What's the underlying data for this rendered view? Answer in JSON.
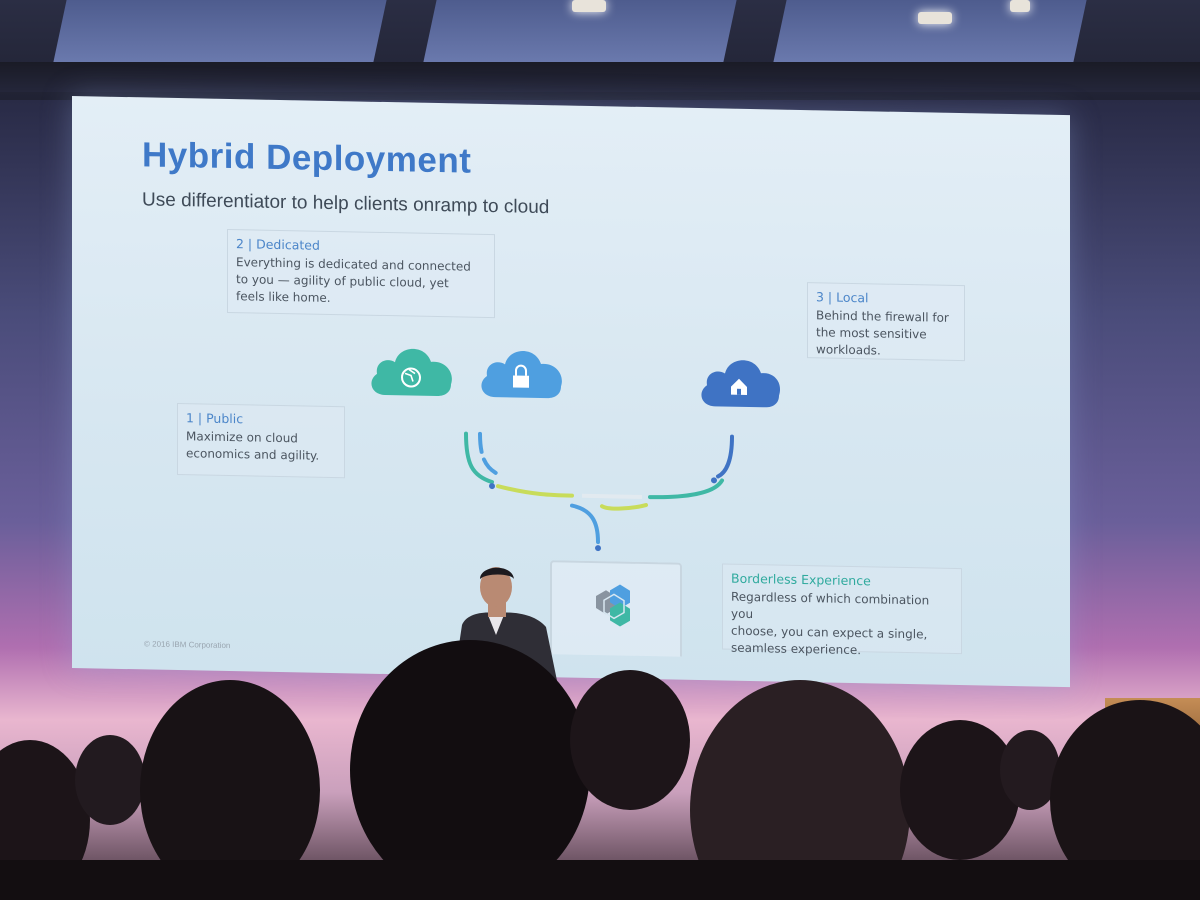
{
  "slide": {
    "title": "Hybrid Deployment",
    "subtitle": "Use differentiator to help clients onramp to cloud",
    "dedicated": {
      "heading": "2 | Dedicated",
      "lines": [
        "Everything is dedicated and connected",
        "to you — agility of public cloud, yet",
        "feels like home."
      ]
    },
    "local": {
      "heading": "3 | Local",
      "lines": [
        "Behind the firewall for",
        "the most sensitive",
        "workloads."
      ]
    },
    "public": {
      "heading": "1 | Public",
      "lines": [
        "Maximize on cloud",
        "economics and agility."
      ]
    },
    "borderless": {
      "heading": "Borderless Experience",
      "lines": [
        "Regardless of which combination you",
        "choose, you can expect a single,",
        "seamless experience."
      ]
    },
    "copyright": "© 2016 IBM Corporation"
  },
  "colors": {
    "title_blue": "#3f79c8",
    "teal": "#3fb8a5",
    "cloud_blue": "#4f9fe0",
    "cloud_navy": "#3f73c4",
    "lime": "#c8dc5a"
  },
  "icons": {
    "public_cloud": "globe-icon",
    "dedicated_cloud": "lock-icon",
    "local_cloud": "home-icon",
    "product": "hexagon-logo-icon"
  }
}
